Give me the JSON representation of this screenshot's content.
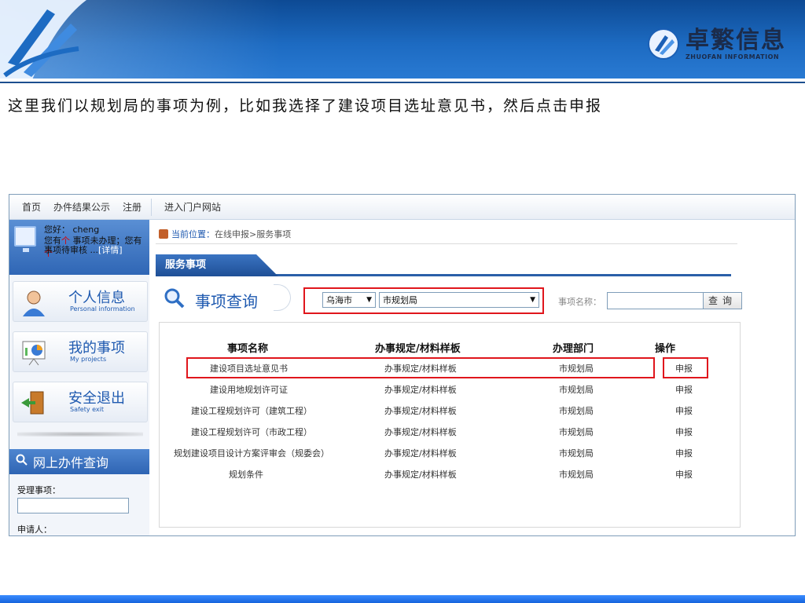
{
  "slide": {
    "brand_cn": "卓繁信息",
    "brand_en": "ZHUOFAN INFORMATION",
    "caption": "这里我们以规划局的事项为例，比如我选择了建设项目选址意见书，然后点击申报"
  },
  "topnav": {
    "items": [
      "首页",
      "办件结果公示",
      "注册",
      "进入门户网站"
    ]
  },
  "user": {
    "greeting": "您好：",
    "name": "cheng",
    "line2_a": "您有",
    "line2_b": "个",
    "line2_c": "事项未办理；您有",
    "line2_d": "个",
    "line3_a": "事项待审核 ...",
    "line3_detail": "[详情]"
  },
  "sidebar": {
    "cards": [
      {
        "title": "个人信息",
        "subtitle": "Personal information"
      },
      {
        "title": "我的事项",
        "subtitle": "My projects"
      },
      {
        "title": "安全退出",
        "subtitle": "Safety exit"
      }
    ],
    "search_title": "网上办件查询",
    "field1_label": "受理事项：",
    "field2_label": "申请人："
  },
  "breadcrumb": {
    "label": "当前位置：",
    "path": "在线申报>服务事项"
  },
  "tab": {
    "label": "服务事项"
  },
  "query": {
    "title": "事项查询",
    "city": "乌海市",
    "dept": "市规划局",
    "name_label": "事项名称：",
    "button": "查询"
  },
  "table": {
    "headers": [
      "事项名称",
      "办事规定/材料样板",
      "办理部门",
      "操作"
    ],
    "rows": [
      {
        "name": "建设项目选址意见书",
        "doc": "办事规定/材料样板",
        "dept": "市规划局",
        "op": "申报"
      },
      {
        "name": "建设用地规划许可证",
        "doc": "办事规定/材料样板",
        "dept": "市规划局",
        "op": "申报"
      },
      {
        "name": "建设工程规划许可（建筑工程）",
        "doc": "办事规定/材料样板",
        "dept": "市规划局",
        "op": "申报"
      },
      {
        "name": "建设工程规划许可（市政工程）",
        "doc": "办事规定/材料样板",
        "dept": "市规划局",
        "op": "申报"
      },
      {
        "name": "规划建设项目设计方案评审会（规委会）",
        "doc": "办事规定/材料样板",
        "dept": "市规划局",
        "op": "申报"
      },
      {
        "name": "规划条件",
        "doc": "办事规定/材料样板",
        "dept": "市规划局",
        "op": "申报"
      }
    ]
  },
  "colors": {
    "header_blue": "#1d6bc2",
    "highlight_red": "#e0161c",
    "link_blue": "#1f5ab0"
  }
}
